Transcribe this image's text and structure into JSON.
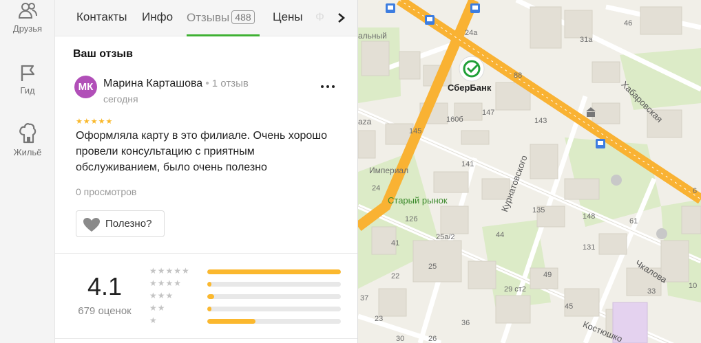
{
  "rail": {
    "friends": "Друзья",
    "guide": "Гид",
    "housing": "Жильё"
  },
  "tabs": {
    "contacts": "Контакты",
    "info": "Инфо",
    "reviews": "Отзывы",
    "reviews_count": "488",
    "prices": "Цены",
    "next_partial": "Ф"
  },
  "review": {
    "section_title": "Ваш отзыв",
    "avatar_initials": "МК",
    "author": "Марина Карташова",
    "author_reviews": "1 отзыв",
    "date": "сегодня",
    "stars": "★★★★★",
    "text": "Оформляла карту в это филиале. Очень хорошо провели консультацию с приятным обслуживанием, было очень полезно",
    "views": "0 просмотров",
    "useful_label": "Полезно?"
  },
  "rating": {
    "value": "4.1",
    "count_label": "679 оценок",
    "distribution": [
      {
        "stars": "★★★★★",
        "fraction": 1.0
      },
      {
        "stars": "★★★★",
        "fraction": 0.03
      },
      {
        "stars": "★★★",
        "fraction": 0.05
      },
      {
        "stars": "★★",
        "fraction": 0.03
      },
      {
        "stars": "★",
        "fraction": 0.36
      }
    ]
  },
  "map": {
    "labels": {
      "h24a": "24а",
      "h31a": "31а",
      "h46": "46",
      "h88": "88",
      "h147": "147",
      "h160b": "160б",
      "h143": "143",
      "h145": "145",
      "h141": "141",
      "h135": "135",
      "h148": "148",
      "h131": "131",
      "h12b": "12б",
      "h25a2": "25а/2",
      "h44": "44",
      "h25": "25",
      "h29st2": "29 ст2",
      "h37": "37",
      "h61": "61",
      "h6": "6",
      "h41": "41",
      "h22": "22",
      "h23": "23",
      "h26": "26",
      "h36": "36",
      "h49": "49",
      "h45": "45",
      "h24": "24",
      "h10": "10",
      "h33": "33",
      "h30": "30"
    },
    "partial_central": "альный",
    "partial_aza": "aza",
    "imperial": "Империал",
    "market": "Старый рынок",
    "bank": "СберБанк",
    "street_khabarovskaya": "Хабаровская",
    "street_kurnatovskogo": "Курнатовского",
    "street_chkalova": "Чкалова",
    "street_kostyushko": "Костюшко"
  },
  "colors": {
    "accent_green": "#3fb133",
    "star": "#f9b82a",
    "bar_fill": "#fbb82e",
    "avatar": "#b14fb8",
    "road": "#f9b233",
    "map_bg": "#f1efe8",
    "park": "#dcebc7"
  }
}
